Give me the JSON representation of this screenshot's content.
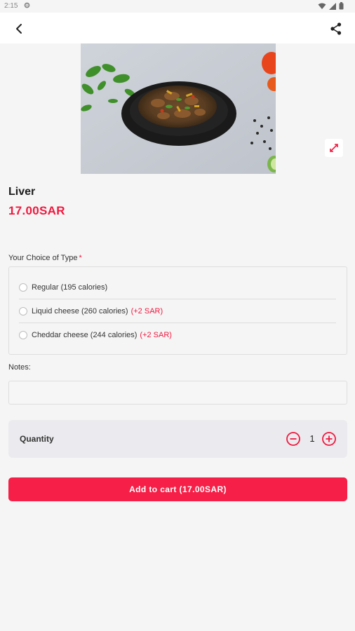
{
  "status": {
    "time": "2:15"
  },
  "product": {
    "name": "Liver",
    "price": "17.00SAR"
  },
  "choice": {
    "title": "Your Choice of Type",
    "required_mark": "*",
    "options": [
      {
        "label": "Regular (195 calories)",
        "extra": ""
      },
      {
        "label": "Liquid cheese (260 calories)",
        "extra": "(+2 SAR)"
      },
      {
        "label": "Cheddar cheese (244 calories)",
        "extra": "(+2 SAR)"
      }
    ]
  },
  "notes": {
    "label": "Notes:",
    "value": "",
    "placeholder": ""
  },
  "quantity": {
    "label": "Quantity",
    "value": "1"
  },
  "cart": {
    "button_label": "Add to cart (17.00SAR)"
  },
  "colors": {
    "accent": "#f51f47",
    "price": "#f0193f"
  },
  "icons": {
    "back": "arrow-left-icon",
    "share": "share-icon",
    "expand": "expand-icon",
    "minus": "minus-circle-icon",
    "plus": "plus-circle-icon"
  }
}
